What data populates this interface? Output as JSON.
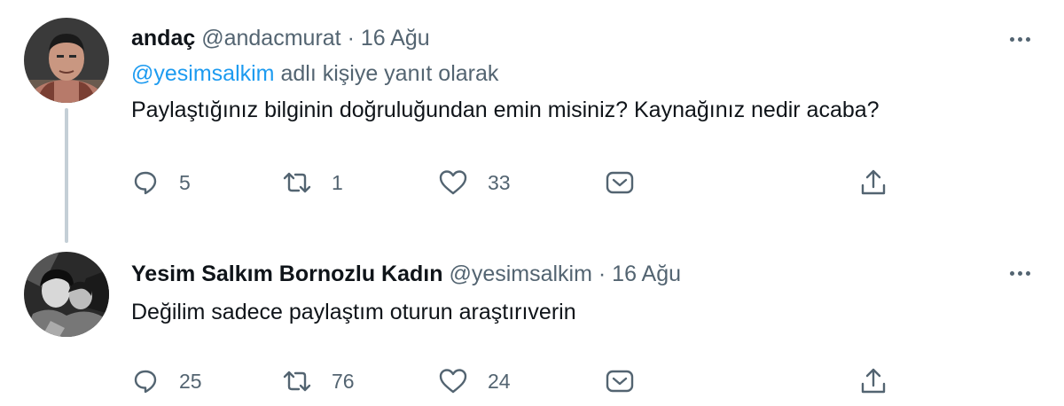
{
  "tweets": [
    {
      "display_name": "andaç",
      "handle": "@andacmurat",
      "separator": "·",
      "date": "16 Ağu",
      "reply_to": {
        "mention": "@yesimsalkim",
        "suffix": "adlı kişiye yanıt olarak"
      },
      "text": "Paylaştığınız bilginin doğruluğundan emin misiniz? Kaynağınız nedir acaba?",
      "actions": {
        "reply_count": "5",
        "retweet_count": "1",
        "like_count": "33"
      }
    },
    {
      "display_name": "Yesim Salkım Bornozlu Kadın",
      "handle": "@yesimsalkim",
      "separator": "·",
      "date": "16 Ağu",
      "text": "Değilim sadece paylaştım oturun araştırıverin",
      "actions": {
        "reply_count": "25",
        "retweet_count": "76",
        "like_count": "24"
      }
    }
  ],
  "icons": {
    "reply": "reply-icon",
    "retweet": "retweet-icon",
    "like": "heart-icon",
    "dm": "dm-icon",
    "share": "share-icon",
    "more": "more-icon"
  },
  "colors": {
    "text": "#0f1419",
    "secondary": "#536471",
    "mention": "#1d9bf0",
    "thread_line": "#c4cfd6"
  }
}
